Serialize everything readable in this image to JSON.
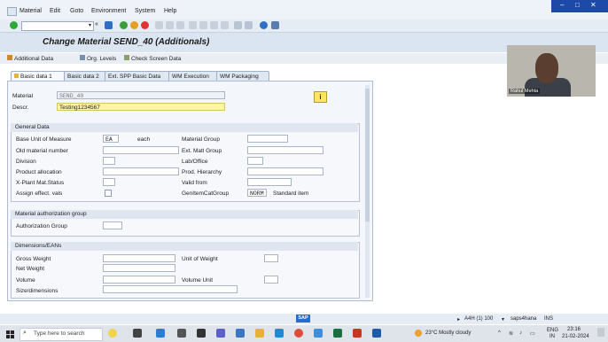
{
  "menubar": {
    "items": [
      "Material",
      "Edit",
      "Goto",
      "Environment",
      "System",
      "Help"
    ]
  },
  "toolbar": {
    "command_value": ""
  },
  "title": "Change Material SEND_40 (Additionals)",
  "app_toolbar": {
    "additional_data": "Additional Data",
    "org_levels": "Org. Levels",
    "check_screen_data": "Check Screen Data"
  },
  "tabs": [
    "Basic data 1",
    "Basic data 2",
    "Ext. SPP Basic Data",
    "WM Execution",
    "WM Packaging"
  ],
  "header": {
    "material_label": "Material",
    "material_value": "SEND_40",
    "descr_label": "Descr.",
    "descr_value": "Testing1234567"
  },
  "general_data": {
    "title": "General Data",
    "base_uom_label": "Base Unit of Measure",
    "base_uom_value": "EA",
    "base_uom_text": "each",
    "old_material_label": "Old material number",
    "division_label": "Division",
    "product_allocation_label": "Product allocation",
    "xplant_status_label": "X-Plant Mat.Status",
    "assign_effect_label": "Assign effect. vals",
    "material_group_label": "Material Group",
    "ext_matl_group_label": "Ext. Matl Group",
    "lab_office_label": "Lab/Office",
    "prod_hierarchy_label": "Prod. Hierarchy",
    "valid_from_label": "Valid from",
    "gen_item_cat_label": "GenItemCatGroup",
    "gen_item_cat_value": "NORM",
    "gen_item_cat_text": "Standard item"
  },
  "auth_group": {
    "title": "Material authorization group",
    "auth_group_label": "Authorization Group"
  },
  "dimensions": {
    "title": "Dimensions/EANs",
    "gross_weight_label": "Gross Weight",
    "net_weight_label": "Net Weight",
    "volume_label": "Volume",
    "size_dimensions_label": "Size/dimensions",
    "unit_of_weight_label": "Unit of Weight",
    "volume_unit_label": "Volume Unit"
  },
  "webcam": {
    "name": "Rahul Mehta"
  },
  "statusbar": {
    "system": "A4H (1) 100",
    "server": "saps4hana",
    "mode": "INS"
  },
  "taskbar": {
    "search_placeholder": "Type here to search",
    "weather": "23°C  Mostly cloudy",
    "lang": "ENG",
    "lang2": "IN",
    "time": "23:16",
    "date": "21-02-2024"
  },
  "colors": {
    "accent": "#1d4aa8",
    "highlight_field": "#fdf4a6"
  }
}
